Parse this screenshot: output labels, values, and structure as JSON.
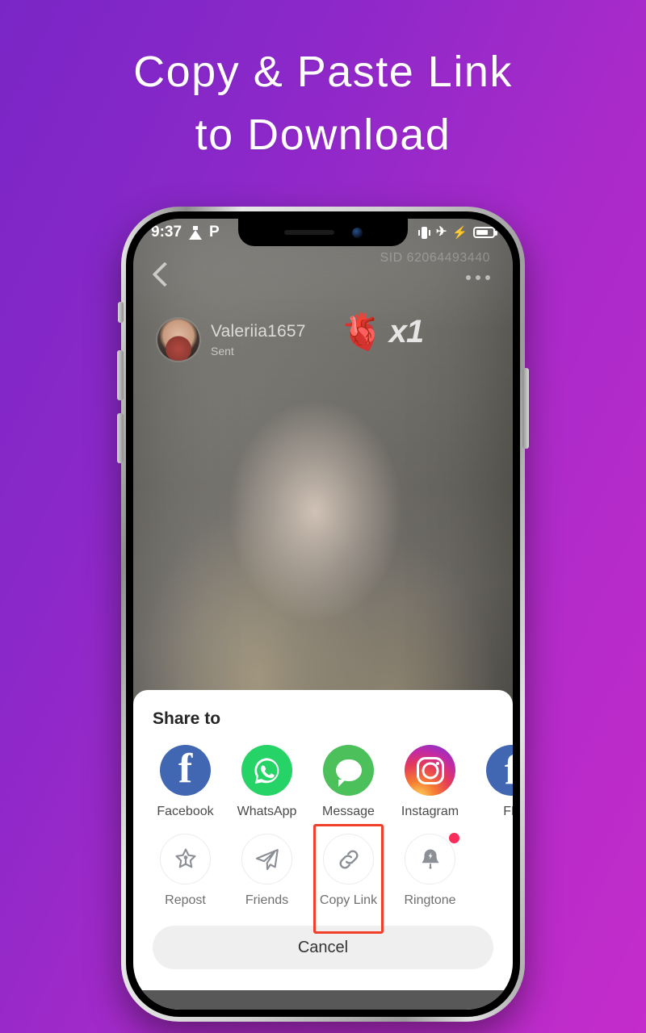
{
  "headline": {
    "line1": "Copy & Paste Link",
    "line2": "to Download"
  },
  "colors": {
    "bg_start": "#7a26c6",
    "bg_end": "#c42ccb",
    "highlight": "#f0402a",
    "badge": "#fa2c5a",
    "facebook": "#4267b2",
    "whatsapp": "#25d366",
    "message": "#4cc05a"
  },
  "statusbar": {
    "time": "9:37",
    "left_icons": [
      "flask-icon",
      "parking-p-icon"
    ],
    "p_label": "P",
    "right_icons": [
      "vibrate-icon",
      "airplane-mode-icon",
      "charging-bolt-icon",
      "battery-icon"
    ],
    "airplane_glyph": "✈",
    "bolt_glyph": "⚡"
  },
  "video": {
    "back_icon": "back-chevron-icon",
    "more_icon": "more-options-icon",
    "watermark": "SID 62064493440",
    "sender_name": "Valeriia1657",
    "sender_status": "Sent",
    "gift_emoji": "🫀",
    "gift_count": "x1"
  },
  "share_sheet": {
    "title": "Share to",
    "row1": [
      {
        "label": "Facebook",
        "icon": "facebook-icon"
      },
      {
        "label": "WhatsApp",
        "icon": "whatsapp-icon"
      },
      {
        "label": "Message",
        "icon": "message-icon"
      },
      {
        "label": "Instagram",
        "icon": "instagram-icon"
      },
      {
        "label": "FB",
        "icon": "facebook-story-icon"
      }
    ],
    "row2": [
      {
        "label": "Repost",
        "icon": "repost-star-icon"
      },
      {
        "label": "Friends",
        "icon": "paper-plane-icon"
      },
      {
        "label": "Copy Link",
        "icon": "link-chain-icon"
      },
      {
        "label": "Ringtone",
        "icon": "bell-bolt-icon"
      }
    ],
    "highlighted_item": "Copy Link",
    "cancel_label": "Cancel"
  }
}
